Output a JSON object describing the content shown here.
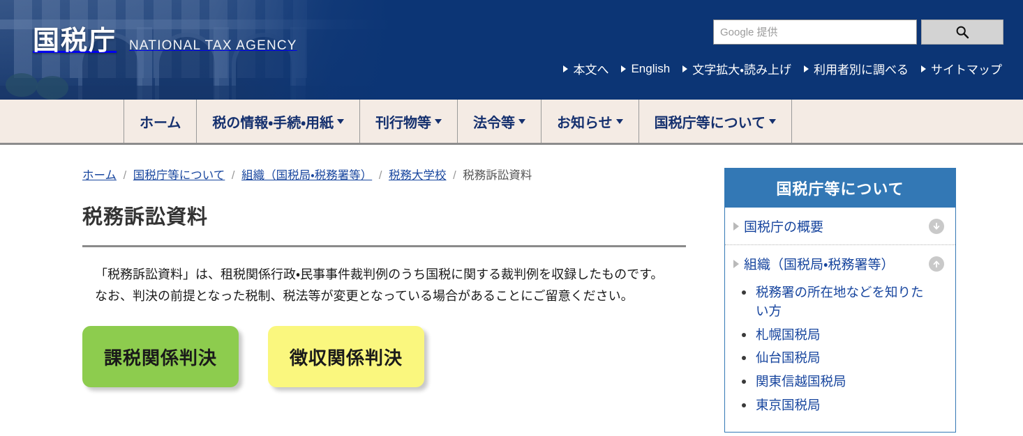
{
  "header": {
    "logo_jp": "国税庁",
    "logo_en": "NATIONAL TAX AGENCY",
    "search": {
      "placeholder": "Google 提供",
      "value": "",
      "button_icon": "search-icon"
    },
    "utility_links": [
      {
        "label": "本文へ"
      },
      {
        "label": "English"
      },
      {
        "label": "文字拡大・読み上げ"
      },
      {
        "label": "利用者別に調べる"
      },
      {
        "label": "サイトマップ"
      }
    ],
    "colors": {
      "background": "#0c3575",
      "text": "#ffffff"
    }
  },
  "main_nav": {
    "items": [
      {
        "label": "ホーム",
        "has_dropdown": false
      },
      {
        "label": "税の情報・手続・用紙",
        "has_dropdown": true
      },
      {
        "label": "刊行物等",
        "has_dropdown": true
      },
      {
        "label": "法令等",
        "has_dropdown": true
      },
      {
        "label": "お知らせ",
        "has_dropdown": true
      },
      {
        "label": "国税庁等について",
        "has_dropdown": true
      }
    ],
    "colors": {
      "background": "#f4ebe4",
      "text": "#15306e"
    }
  },
  "breadcrumb": {
    "items": [
      {
        "label": "ホーム",
        "is_link": true
      },
      {
        "label": "国税庁等について",
        "is_link": true
      },
      {
        "label": "組織（国税局・税務署等）",
        "is_link": true
      },
      {
        "label": "税務大学校",
        "is_link": true
      },
      {
        "label": "税務訴訟資料",
        "is_link": false
      }
    ],
    "separator": "/"
  },
  "main": {
    "page_title": "税務訴訟資料",
    "paragraphs": [
      "「税務訴訟資料」は、租税関係行政・民事事件裁判例のうち国税に関する裁判例を収録したものです。",
      "なお、判決の前提となった税制、税法等が変更となっている場合があることにご留意ください。"
    ],
    "buttons": [
      {
        "label": "課税関係判決",
        "color": "#8dcc4e"
      },
      {
        "label": "徴収関係判決",
        "color": "#faf77e"
      }
    ]
  },
  "sidebar": {
    "title": "国税庁等について",
    "header_color": "#3378b5",
    "sections": [
      {
        "label": "国税庁の概要",
        "expanded": false,
        "toggle_icon": "arrow-down-circle-icon"
      },
      {
        "label": "組織（国税局・税務署等）",
        "expanded": true,
        "toggle_icon": "arrow-up-circle-icon"
      }
    ],
    "sub_items": [
      {
        "label": "税務署の所在地などを知りたい方"
      },
      {
        "label": "札幌国税局"
      },
      {
        "label": "仙台国税局"
      },
      {
        "label": "関東信越国税局"
      },
      {
        "label": "東京国税局"
      }
    ]
  }
}
